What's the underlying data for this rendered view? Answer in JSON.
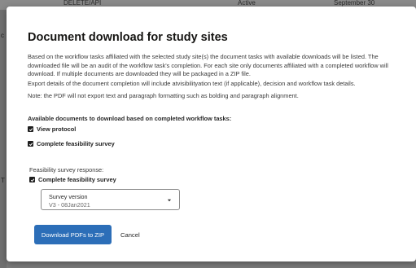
{
  "background": {
    "strip_texts": [
      "DELETE/API",
      "Active",
      "September 30"
    ],
    "left_edge_texts": [
      "c",
      "T"
    ]
  },
  "modal": {
    "title": "Document download for study sites",
    "paragraphs": [
      "Based on the workflow tasks affiliated with the selected study site(s) the document tasks with available downloads will be listed. The downloaded file will be an audit of the workflow task's completion. For each site only documents affiliated with a completed workflow will download. If multiple documents are downloaded they will be packaged in a ZIP file.",
      "Export details of the document completion will include atvisibilityation text (if applicable), decision and workflow task details.",
      "Note: the PDF will not export text and paragraph formatting such as bolding and paragraph alignment."
    ],
    "available_docs": {
      "label": "Available documents to download based on completed workflow tasks:",
      "items": [
        {
          "label": "View protocol",
          "checked": true
        },
        {
          "label": "Complete feasibility survey",
          "checked": true
        }
      ]
    },
    "feasibility": {
      "label": "Feasibility survey response:",
      "item": {
        "label": "Complete feasibility survey",
        "checked": true
      },
      "select": {
        "label": "Survey version",
        "value": "V3 - 08Jan2021",
        "icon": "chevron-down-icon"
      }
    },
    "buttons": {
      "primary": "Download PDFs to ZIP",
      "cancel": "Cancel"
    }
  },
  "colors": {
    "primary": "#2c6eb8",
    "overlay": "#7a7a7a"
  }
}
